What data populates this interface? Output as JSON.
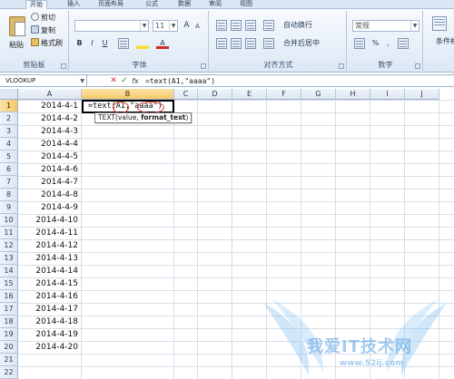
{
  "tabs": [
    {
      "label": "开始",
      "active": true
    },
    {
      "label": "插入",
      "active": false
    },
    {
      "label": "页面布局",
      "active": false
    },
    {
      "label": "公式",
      "active": false
    },
    {
      "label": "数据",
      "active": false
    },
    {
      "label": "审阅",
      "active": false
    },
    {
      "label": "视图",
      "active": false
    }
  ],
  "clipboard": {
    "paste": "粘贴",
    "cut": "剪切",
    "copy": "复制",
    "format_painter": "格式刷",
    "group_label": "剪贴板"
  },
  "font": {
    "size": "11",
    "bold": "B",
    "italic": "I",
    "underline": "U",
    "grow": "A",
    "shrink": "A",
    "color_a": "A",
    "group_label": "字体"
  },
  "alignment": {
    "wrap_text": "自动换行",
    "merge_center": "合并后居中",
    "group_label": "对齐方式"
  },
  "number": {
    "format": "常规",
    "percent": "%",
    "comma": ",",
    "group_label": "数字"
  },
  "styles": {
    "conditional": "条件格"
  },
  "formula_bar": {
    "name_box": "VLOOKUP",
    "cancel": "✕",
    "enter": "✓",
    "fx": "fx",
    "formula": "=text(A1,\"aaaa\")"
  },
  "sheet": {
    "columns": [
      "A",
      "B",
      "C",
      "D",
      "E",
      "F",
      "G",
      "H",
      "I",
      "J"
    ],
    "selected_column": "B",
    "rows": [
      "1",
      "2",
      "3",
      "4",
      "5",
      "6",
      "7",
      "8",
      "9",
      "10",
      "11",
      "12",
      "13",
      "14",
      "15",
      "16",
      "17",
      "18",
      "19",
      "20",
      "21",
      "22"
    ],
    "selected_row": "1",
    "col_a_values": [
      "2014-4-1",
      "2014-4-2",
      "2014-4-3",
      "2014-4-4",
      "2014-4-5",
      "2014-4-6",
      "2014-4-7",
      "2014-4-8",
      "2014-4-9",
      "2014-4-10",
      "2014-4-11",
      "2014-4-12",
      "2014-4-13",
      "2014-4-14",
      "2014-4-15",
      "2014-4-16",
      "2014-4-17",
      "2014-4-18",
      "2014-4-19",
      "2014-4-20"
    ],
    "active_cell_text": "=text(A1,\"aaaa\")",
    "tooltip_fn": "TEXT(value, ",
    "tooltip_arg": "format_text",
    "tooltip_end": ")"
  },
  "watermark": {
    "text": "我爱IT技术网",
    "url": "www.52ij.com"
  }
}
